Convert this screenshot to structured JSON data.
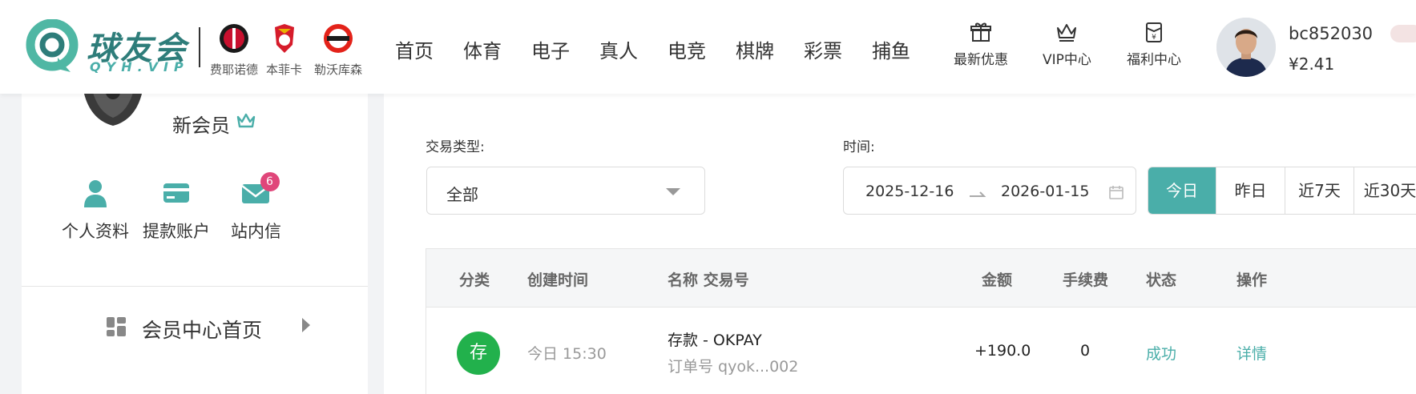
{
  "header": {
    "logo_text": "球友会",
    "logo_sub": "QYH.VIP",
    "clubs": [
      {
        "name": "费耶诺德",
        "icon": "feyenoord-badge-icon"
      },
      {
        "name": "本菲卡",
        "icon": "benfica-badge-icon"
      },
      {
        "name": "勒沃库森",
        "icon": "leverkusen-badge-icon"
      }
    ],
    "nav": [
      "首页",
      "体育",
      "电子",
      "真人",
      "电竞",
      "棋牌",
      "彩票",
      "捕鱼"
    ],
    "tools": [
      {
        "label": "最新优惠",
        "icon": "gift-icon"
      },
      {
        "label": "VIP中心",
        "icon": "crown-icon"
      },
      {
        "label": "福利中心",
        "icon": "red-envelope-icon"
      }
    ],
    "user": {
      "name": "bc852030",
      "balance": "¥2.41"
    }
  },
  "sidebar": {
    "member_level": "新会员",
    "actions": [
      {
        "label": "个人资料",
        "icon": "user-icon"
      },
      {
        "label": "提款账户",
        "icon": "card-icon"
      },
      {
        "label": "站内信",
        "icon": "mail-icon",
        "badge": "6"
      }
    ],
    "menu_item": "会员中心首页"
  },
  "filters": {
    "type_label": "交易类型:",
    "type_value": "全部",
    "time_label": "时间:",
    "date_start": "2025-12-16",
    "date_end": "2026-01-15",
    "quick": [
      "今日",
      "昨日",
      "近7天",
      "近30天"
    ],
    "active_quick": "今日"
  },
  "table": {
    "headers": [
      "分类",
      "创建时间",
      "名称 交易号",
      "金额",
      "手续费",
      "状态",
      "操作"
    ],
    "rows": [
      {
        "type": "存",
        "time": "今日 15:30",
        "name": "存款 - OKPAY",
        "order": "订单号 qyok...002",
        "amount": "+190.0",
        "fee": "0",
        "status": "成功",
        "action": "详情"
      }
    ]
  },
  "colors": {
    "accent": "#4aaea9",
    "deposit": "#22b14c",
    "badge": "#e0467a"
  }
}
